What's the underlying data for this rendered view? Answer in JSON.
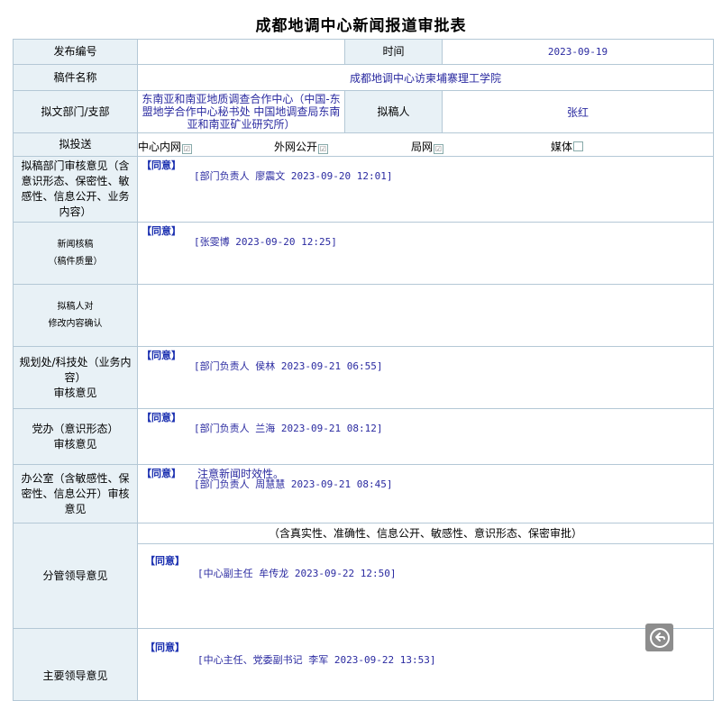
{
  "title": "成都地调中心新闻报道审批表",
  "row_publish": {
    "label": "发布编号",
    "value": "",
    "time_label": "时间",
    "time_value": "2023-09-19"
  },
  "row_name": {
    "label": "稿件名称",
    "value": "成都地调中心访柬埔寨理工学院"
  },
  "row_dept": {
    "label": "拟文部门/支部",
    "value": "东南亚和南亚地质调查合作中心（中国-东盟地学合作中心秘书处 中国地调查局东南亚和南亚矿业研究所）",
    "drafter_label": "拟稿人",
    "drafter_value": "张红"
  },
  "row_send": {
    "label": "拟投送",
    "items": [
      {
        "label": "中心内网",
        "checked": "☑"
      },
      {
        "label": "外网公开",
        "checked": "☑"
      },
      {
        "label": "局网",
        "checked": "☑"
      },
      {
        "label": "媒体",
        "checked": ""
      }
    ]
  },
  "row_dept_opinion": {
    "label": "拟稿部门审核意见（含意识形态、保密性、敏感性、信息公开、业务内容）",
    "agree": "【同意】",
    "sign": "[部门负责人 廖震文 2023-09-20 12:01]"
  },
  "row_news": {
    "label_line1": "新闻核稿",
    "label_line2": "（稿件质量）",
    "agree": "【同意】",
    "sign": "[张雯博 2023-09-20 12:25]"
  },
  "row_confirm": {
    "label_line1": "拟稿人对",
    "label_line2": "修改内容确认"
  },
  "row_plan": {
    "label": "规划处/科技处（业务内容）",
    "label_line2": "审核意见",
    "agree": "【同意】",
    "sign": "[部门负责人 侯林 2023-09-21 06:55]"
  },
  "row_party": {
    "label": "党办（意识形态）",
    "label_line2": "审核意见",
    "agree": "【同意】",
    "sign": "[部门负责人 兰海 2023-09-21 08:12]"
  },
  "row_office": {
    "label": "办公室（含敏感性、保密性、信息公开）审核意见",
    "agree": "【同意】",
    "note": "注意新闻时效性。",
    "sign": "[部门负责人 周慧慧 2023-09-21 08:45]"
  },
  "row_leader": {
    "label": "分管领导意见",
    "header": "（含真实性、准确性、信息公开、敏感性、意识形态、保密审批）",
    "agree": "【同意】",
    "sign": "[中心副主任 牟传龙 2023-09-22 12:50]"
  },
  "row_main": {
    "label": "主要领导意见",
    "agree": "【同意】",
    "sign": "[中心主任、党委副书记 李军 2023-09-22 13:53]"
  }
}
